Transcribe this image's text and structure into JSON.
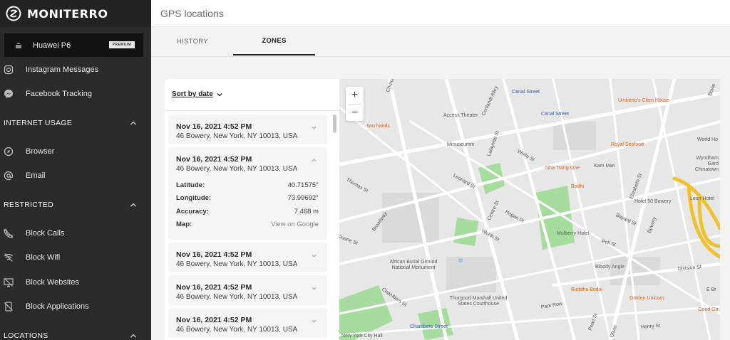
{
  "brand": {
    "name": "MONITERRO"
  },
  "device": {
    "name": "Huawei P6",
    "badge": "PREMIUM"
  },
  "sidebar": {
    "top_items": [
      {
        "label": "Instagram Messages",
        "icon": "instagram-icon"
      },
      {
        "label": "Facebook Tracking",
        "icon": "messenger-icon"
      }
    ],
    "internet_usage": {
      "title": "INTERNET USAGE",
      "items": [
        {
          "label": "Browser",
          "icon": "compass-icon"
        },
        {
          "label": "Email",
          "icon": "at-icon"
        }
      ]
    },
    "restricted": {
      "title": "RESTRICTED",
      "items": [
        {
          "label": "Block Calls",
          "icon": "phone-blocked-icon"
        },
        {
          "label": "Block Wifi",
          "icon": "wifi-blocked-icon"
        },
        {
          "label": "Block Websites",
          "icon": "monitor-blocked-icon"
        },
        {
          "label": "Block Applications",
          "icon": "app-blocked-icon"
        }
      ]
    },
    "locations": {
      "title": "LOCATIONS"
    }
  },
  "header": {
    "title": "GPS locations"
  },
  "tabs": [
    {
      "label": "HISTORY",
      "active": false
    },
    {
      "label": "ZONES",
      "active": true
    }
  ],
  "list": {
    "sort_label": "Sort by date",
    "entries": [
      {
        "date": "Nov 16, 2021 4:52 PM",
        "address": "46 Bowery, New York, NY 10013, USA",
        "expanded": false
      },
      {
        "date": "Nov 16, 2021 4:52 PM",
        "address": "46 Bowery, New York, NY 10013, USA",
        "expanded": true,
        "details": {
          "latitude_label": "Latitude:",
          "latitude": "40.71575°",
          "longitude_label": "Longitude:",
          "longitude": "73.99692°",
          "accuracy_label": "Accuracy:",
          "accuracy": "7.468 m",
          "map_label": "Map:",
          "map_link": "View on Google"
        }
      },
      {
        "date": "Nov 16, 2021 4:52 PM",
        "address": "46 Bowery, New York, NY 10013, USA",
        "expanded": false
      },
      {
        "date": "Nov 16, 2021 4:52 PM",
        "address": "46 Bowery, New York, NY 10013, USA",
        "expanded": false
      },
      {
        "date": "Nov 16, 2021 4:52 PM",
        "address": "46 Bowery, New York, NY 10013, USA",
        "expanded": false
      }
    ]
  },
  "map": {
    "zoom_in": "+",
    "zoom_out": "−",
    "pois": [
      {
        "label": "Canal Street",
        "kind": "transit"
      },
      {
        "label": "Canal Street",
        "kind": "transit"
      },
      {
        "label": "Umberto's Clam House",
        "kind": "food"
      },
      {
        "label": "Access Theater",
        "kind": "place"
      },
      {
        "label": "two hands",
        "kind": "food"
      },
      {
        "label": "Mmuseumm",
        "kind": "place"
      },
      {
        "label": "Royal Seafood",
        "kind": "food"
      },
      {
        "label": "World Ho",
        "kind": "place"
      },
      {
        "label": "Wyndham Gard Chinatown",
        "kind": "place"
      },
      {
        "label": "Nha Trang One",
        "kind": "food"
      },
      {
        "label": "Kam Man",
        "kind": "place"
      },
      {
        "label": "Bodhi",
        "kind": "food"
      },
      {
        "label": "Hotel 50 Bowery",
        "kind": "place"
      },
      {
        "label": "Leon Hotel",
        "kind": "place"
      },
      {
        "label": "Mulberry Hotel",
        "kind": "place"
      },
      {
        "label": "African Burial Ground National Monument",
        "kind": "place"
      },
      {
        "label": "Bloody Angle",
        "kind": "place"
      },
      {
        "label": "Thurgood Marshall United States Courthouse",
        "kind": "place"
      },
      {
        "label": "Buddha Bodai",
        "kind": "food"
      },
      {
        "label": "Golden Unicorn",
        "kind": "food"
      },
      {
        "label": "Good Go",
        "kind": "food"
      },
      {
        "label": "Chambers Street",
        "kind": "transit"
      },
      {
        "label": "New York City Hall",
        "kind": "place"
      }
    ],
    "streets": [
      "Thomas St",
      "Broadway",
      "Leonard St",
      "Lafayette St",
      "Centre St",
      "Hogan Pl",
      "Worth St",
      "White St",
      "Elizabeth St",
      "Bayard St",
      "Pell St",
      "Bowery",
      "Division St",
      "Park Row",
      "Chambers St",
      "Pearl St",
      "Henry St",
      "E Br",
      "Cortlandt Alley",
      "Church",
      "Oliver",
      "Duane St",
      "Bowe"
    ]
  },
  "colors": {
    "sidebar_bg": "#2b2b2b",
    "park": "#9ed99a",
    "highlight_road": "#f2c12e",
    "poi_food": "#cf6a2c",
    "transit": "#3a5fb0"
  }
}
